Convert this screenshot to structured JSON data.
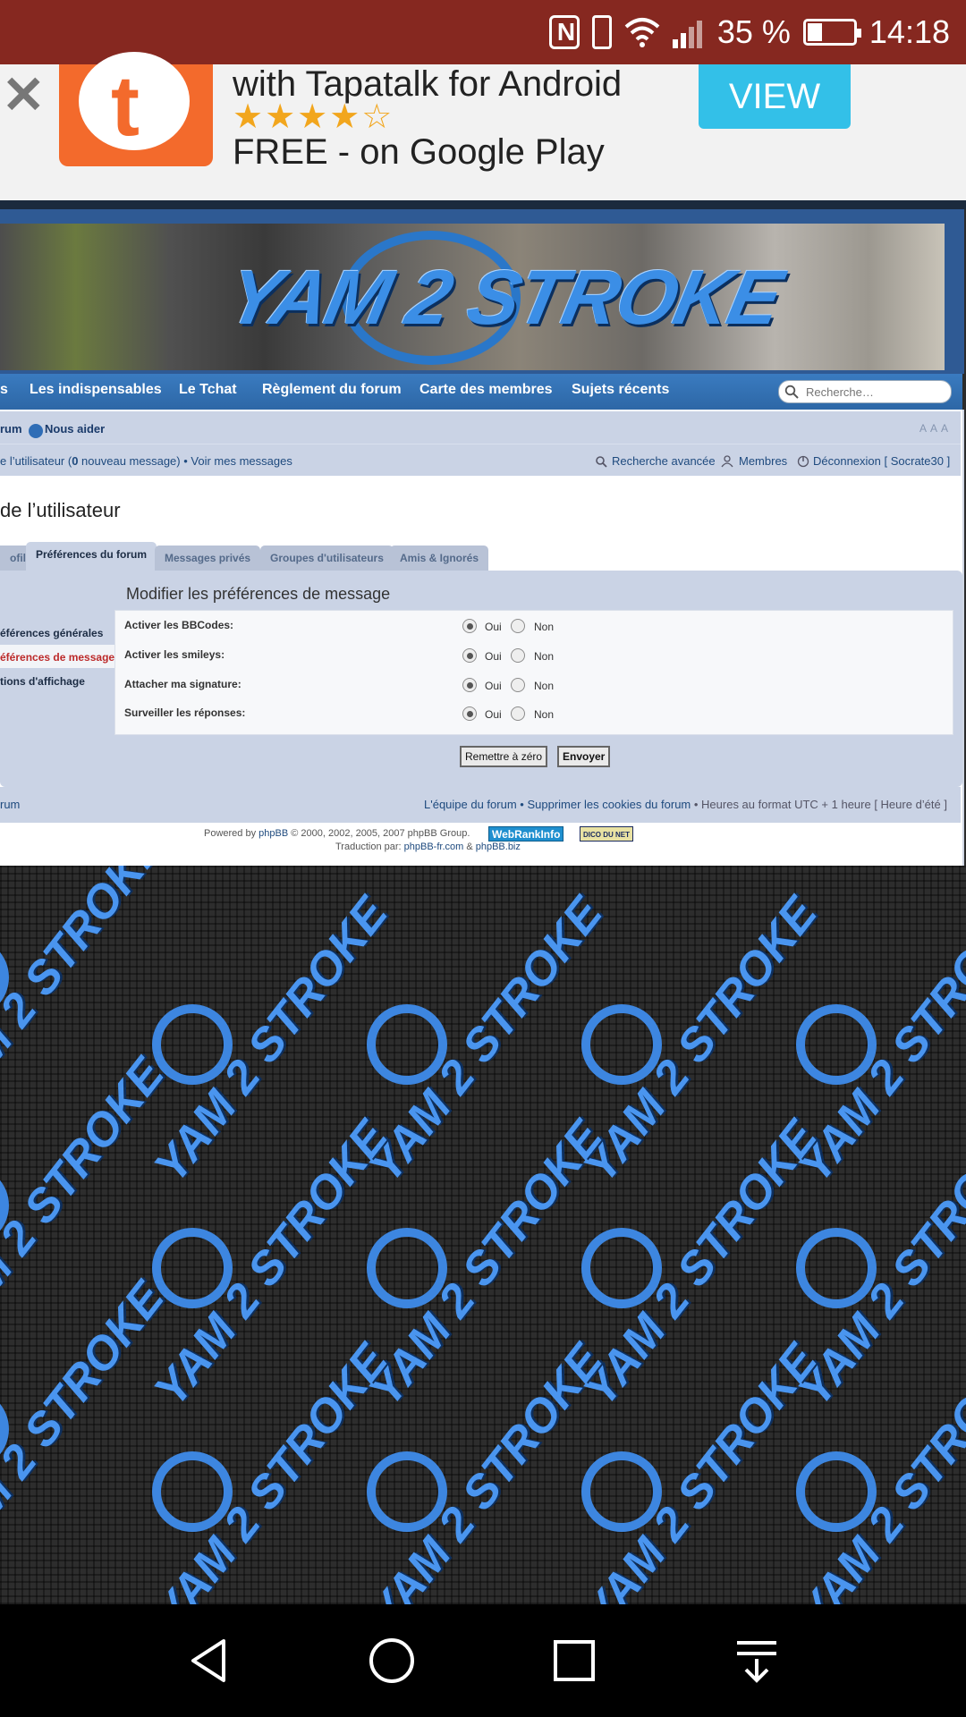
{
  "status_bar": {
    "battery": "35 %",
    "time": "14:18",
    "icons": [
      "nfc-icon",
      "vibrate-icon",
      "wifi-icon",
      "signal-icon",
      "battery-icon"
    ]
  },
  "ad": {
    "title": "with Tapatalk for Android",
    "stars": "★★★★☆",
    "rating": 4.5,
    "subtitle": "FREE - on Google Play",
    "button": "VIEW",
    "close": "✕",
    "logo_letter": "t",
    "accent": "#33c0e8",
    "logo_color": "#f36a2c"
  },
  "banner": {
    "logo_text": "YAM 2 STROKE"
  },
  "nav": {
    "items": [
      {
        "label": "s"
      },
      {
        "label": "Les indispensables"
      },
      {
        "label": "Le Tchat"
      },
      {
        "label": "Règlement du forum"
      },
      {
        "label": "Carte des membres"
      },
      {
        "label": "Sujets récents"
      }
    ],
    "search_placeholder": "Recherche…"
  },
  "subnav": {
    "forum": "rum",
    "help": "Nous aider",
    "font_controls": "A A A",
    "messages_prefix": "e l’utilisateur (",
    "new_count": "0",
    "messages_suffix": " nouveau message) • Voir mes messages",
    "advanced_search": "Recherche avancée",
    "members": "Membres",
    "logout": "Déconnexion [ Socrate30 ]"
  },
  "page": {
    "title": "de l’utilisateur"
  },
  "tabs": [
    {
      "label": "ofil"
    },
    {
      "label": "Préférences du forum"
    },
    {
      "label": "Messages privés"
    },
    {
      "label": "Groupes d'utilisateurs"
    },
    {
      "label": "Amis & Ignorés"
    }
  ],
  "sidebar": {
    "items": [
      {
        "label": "éférences générales"
      },
      {
        "label": "éférences de message"
      },
      {
        "label": "tions d'affichage"
      }
    ]
  },
  "panel": {
    "title": "Modifier les préférences de message",
    "options": [
      {
        "label": "Activer les BBCodes:",
        "value": "Oui"
      },
      {
        "label": "Activer les smileys:",
        "value": "Oui"
      },
      {
        "label": "Attacher ma signature:",
        "value": "Oui"
      },
      {
        "label": "Surveiller les réponses:",
        "value": "Oui"
      }
    ],
    "yes": "Oui",
    "no": "Non",
    "reset_button": "Remettre à zéro",
    "submit_button": "Envoyer"
  },
  "footer": {
    "forum": "rum",
    "team": "L'équipe du forum",
    "cookies": "Supprimer les cookies du forum",
    "timezone": " • Heures au format UTC + 1 heure [ Heure d’été ]",
    "powered_prefix": "Powered by ",
    "phpbb": "phpBB",
    "copyright": " © 2000, 2002, 2005, 2007 phpBB Group.",
    "webrank": "WebRankInfo",
    "dico": "DICO DU NET",
    "translation_prefix": "Traduction par: ",
    "translation_site1": "phpBB-fr.com",
    "translation_amp": " & ",
    "translation_site2": "phpBB.biz"
  },
  "system_nav": {
    "buttons": [
      "back-icon",
      "home-icon",
      "recents-icon",
      "notification-pull-icon"
    ]
  }
}
